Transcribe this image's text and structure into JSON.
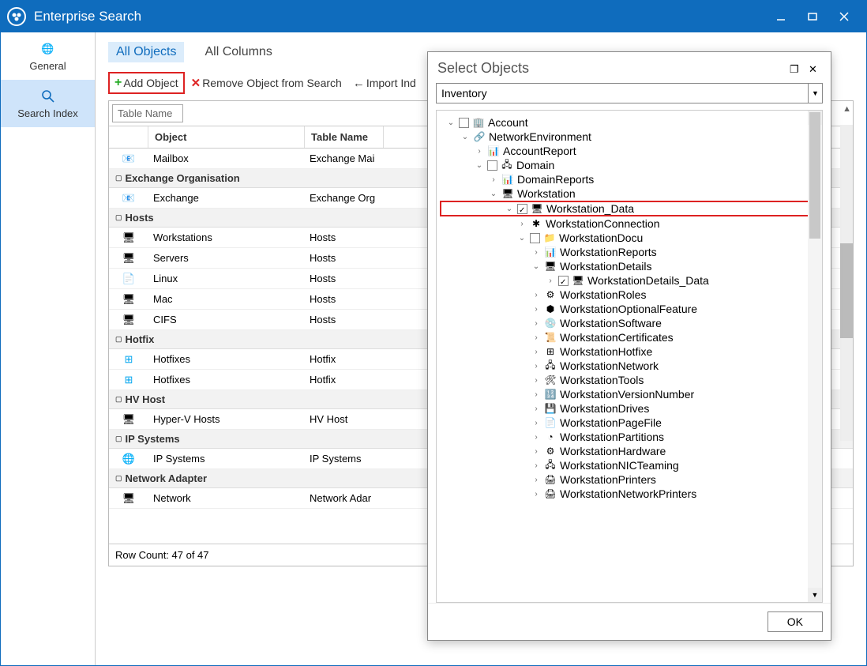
{
  "window": {
    "title": "Enterprise Search"
  },
  "sidebar": {
    "items": [
      {
        "label": "General"
      },
      {
        "label": "Search Index"
      }
    ]
  },
  "tabs": [
    {
      "label": "All Objects",
      "active": true
    },
    {
      "label": "All Columns",
      "active": false
    }
  ],
  "toolbar": {
    "add": "Add Object",
    "remove": "Remove Object from Search",
    "import": "Import Ind"
  },
  "filter": {
    "placeholder": "Table Name"
  },
  "columns": {
    "c2": "Object",
    "c3": "Table Name"
  },
  "groups": [
    {
      "name": "",
      "rows": [
        {
          "obj": "Mailbox",
          "tbl": "Exchange Mai"
        }
      ]
    },
    {
      "name": "Exchange Organisation",
      "rows": [
        {
          "obj": "Exchange",
          "tbl": "Exchange Org"
        }
      ]
    },
    {
      "name": "Hosts",
      "rows": [
        {
          "obj": "Workstations",
          "tbl": "Hosts"
        },
        {
          "obj": "Servers",
          "tbl": "Hosts"
        },
        {
          "obj": "Linux",
          "tbl": "Hosts"
        },
        {
          "obj": "Mac",
          "tbl": "Hosts"
        },
        {
          "obj": "CIFS",
          "tbl": "Hosts"
        }
      ]
    },
    {
      "name": "Hotfix",
      "rows": [
        {
          "obj": "Hotfixes",
          "tbl": "Hotfix"
        },
        {
          "obj": "Hotfixes",
          "tbl": "Hotfix"
        }
      ]
    },
    {
      "name": "HV Host",
      "rows": [
        {
          "obj": "Hyper-V Hosts",
          "tbl": "HV Host"
        }
      ]
    },
    {
      "name": "IP Systems",
      "rows": [
        {
          "obj": "IP Systems",
          "tbl": "IP Systems"
        }
      ]
    },
    {
      "name": "Network Adapter",
      "rows": [
        {
          "obj": "Network",
          "tbl": "Network Adar"
        }
      ]
    }
  ],
  "rowcount": "Row Count: 47 of 47",
  "dialog": {
    "title": "Select Objects",
    "combo": "Inventory",
    "ok": "OK",
    "tree": [
      {
        "d": 0,
        "exp": "v",
        "cb": true,
        "checked": false,
        "label": "Account",
        "icon": "building"
      },
      {
        "d": 1,
        "exp": "v",
        "cb": false,
        "label": "NetworkEnvironment",
        "icon": "net"
      },
      {
        "d": 2,
        "exp": ">",
        "cb": false,
        "label": "AccountReport",
        "icon": "report"
      },
      {
        "d": 2,
        "exp": "v",
        "cb": true,
        "checked": false,
        "label": "Domain",
        "icon": "domain"
      },
      {
        "d": 3,
        "exp": ">",
        "cb": false,
        "label": "DomainReports",
        "icon": "report"
      },
      {
        "d": 3,
        "exp": "v",
        "cb": false,
        "label": "Workstation",
        "icon": "ws"
      },
      {
        "d": 4,
        "exp": "v",
        "cb": true,
        "checked": true,
        "label": "Workstation_Data",
        "icon": "ws",
        "hl": true
      },
      {
        "d": 5,
        "exp": ">",
        "cb": false,
        "label": "WorkstationConnection",
        "icon": "conn"
      },
      {
        "d": 5,
        "exp": "v",
        "cb": true,
        "checked": false,
        "label": "WorkstationDocu",
        "icon": "doc"
      },
      {
        "d": 6,
        "exp": ">",
        "cb": false,
        "label": "WorkstationReports",
        "icon": "report"
      },
      {
        "d": 6,
        "exp": "v",
        "cb": false,
        "label": "WorkstationDetails",
        "icon": "ws"
      },
      {
        "d": 7,
        "exp": ">",
        "cb": true,
        "checked": true,
        "label": "WorkstationDetails_Data",
        "icon": "ws"
      },
      {
        "d": 6,
        "exp": ">",
        "cb": false,
        "label": "WorkstationRoles",
        "icon": "roles"
      },
      {
        "d": 6,
        "exp": ">",
        "cb": false,
        "label": "WorkstationOptionalFeature",
        "icon": "feat"
      },
      {
        "d": 6,
        "exp": ">",
        "cb": false,
        "label": "WorkstationSoftware",
        "icon": "sw"
      },
      {
        "d": 6,
        "exp": ">",
        "cb": false,
        "label": "WorkstationCertificates",
        "icon": "cert"
      },
      {
        "d": 6,
        "exp": ">",
        "cb": false,
        "label": "WorkstationHotfixe",
        "icon": "win"
      },
      {
        "d": 6,
        "exp": ">",
        "cb": false,
        "label": "WorkstationNetwork",
        "icon": "neticon"
      },
      {
        "d": 6,
        "exp": ">",
        "cb": false,
        "label": "WorkstationTools",
        "icon": "tools"
      },
      {
        "d": 6,
        "exp": ">",
        "cb": false,
        "label": "WorkstationVersionNumber",
        "icon": "ver"
      },
      {
        "d": 6,
        "exp": ">",
        "cb": false,
        "label": "WorkstationDrives",
        "icon": "drive"
      },
      {
        "d": 6,
        "exp": ">",
        "cb": false,
        "label": "WorkstationPageFile",
        "icon": "page"
      },
      {
        "d": 6,
        "exp": ">",
        "cb": false,
        "label": "WorkstationPartitions",
        "icon": "part"
      },
      {
        "d": 6,
        "exp": ">",
        "cb": false,
        "label": "WorkstationHardware",
        "icon": "hw"
      },
      {
        "d": 6,
        "exp": ">",
        "cb": false,
        "label": "WorkstationNICTeaming",
        "icon": "nic"
      },
      {
        "d": 6,
        "exp": ">",
        "cb": false,
        "label": "WorkstationPrinters",
        "icon": "print"
      },
      {
        "d": 6,
        "exp": ">",
        "cb": false,
        "label": "WorkstationNetworkPrinters",
        "icon": "print"
      }
    ]
  }
}
